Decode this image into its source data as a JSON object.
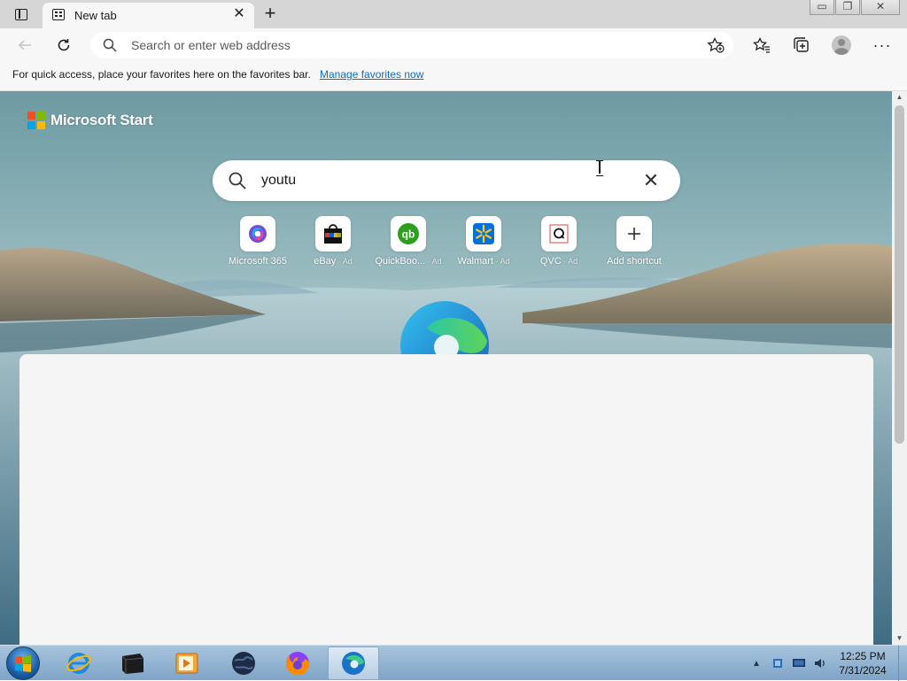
{
  "browser": {
    "tab": {
      "title": "New tab"
    },
    "window_buttons": {
      "minimize": "▭",
      "restore": "❐",
      "close": "✕"
    }
  },
  "toolbar": {
    "address_placeholder": "Search or enter web address",
    "address_value": ""
  },
  "favorites_bar": {
    "message": "For quick access, place your favorites here on the favorites bar.",
    "link": "Manage favorites now"
  },
  "new_tab_page": {
    "brand": "Microsoft Start",
    "search": {
      "value": "youtu"
    },
    "shortcuts": [
      {
        "label": "Microsoft 365",
        "ad": ""
      },
      {
        "label": "eBay",
        "ad": " · Ad"
      },
      {
        "label": "QuickBoo...",
        "ad": " · Ad"
      },
      {
        "label": "Walmart",
        "ad": " · Ad"
      },
      {
        "label": "QVC",
        "ad": " · Ad"
      },
      {
        "label": "Add shortcut",
        "ad": ""
      }
    ]
  },
  "taskbar": {
    "clock_time": "12:25 PM",
    "clock_date": "7/31/2024"
  },
  "colors": {
    "ms_logo": [
      "#f25022",
      "#7fba00",
      "#00a4ef",
      "#ffb900"
    ],
    "link": "#0f6cbd",
    "quickbooks": "#2ca01c",
    "walmart": "#0071dc"
  }
}
